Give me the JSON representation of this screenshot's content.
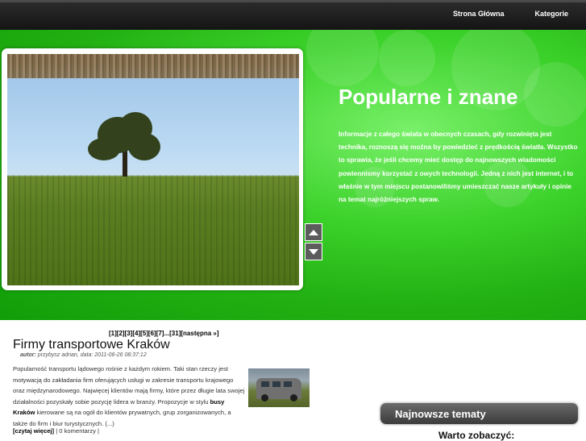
{
  "nav": {
    "items": [
      {
        "label": "Strona Główna"
      },
      {
        "label": "Kategorie"
      }
    ]
  },
  "hero": {
    "title": "Popularne i znane",
    "text": "Informacje z całego świata w obecnych czasach, gdy rozwinięta jest technika, roznoszą się można by powiedzieć z prędkością światła. Wszystko to sprawia, że jeśli chcemy mieć dostęp do najnowszych wiadomości powiennismy korzystać z owych technologii. Jedną z nich jest internet, i to właśnie w tym miejscu postanowiliśmy umieszczać nasze artykuły i opinie na temat najróżniejszych spraw.",
    "slider": {
      "up_icon": "arrow-up-icon",
      "down_icon": "arrow-down-icon"
    }
  },
  "pagination": {
    "pages": [
      "[1]",
      "[2]",
      "[3]",
      "[4]",
      "[5]",
      "[6]",
      "[7]",
      "...",
      "[31]"
    ],
    "next": "[następna »]"
  },
  "post": {
    "title": "Firmy transportowe Kraków",
    "author_label": "autor:",
    "author": "przybysz adrian,",
    "date": "data: 2011-06-26 08:37:12",
    "body_before": "Popularność transportu lądowego rośnie z każdym rokiem. Taki stan rzeczy jest motywacją do zakładania firm oferujących usługi w zakresie transportu krajowego oraz międzynarodowego. Najwięcej klientów mają firmy, które przez długie lata swojej działalności pozyskały sobie pozycję lidera w branży. Propozycje w stylu ",
    "body_bold": "busy Kraków",
    "body_after": " kierowane są na ogół do klientów prywatnych, grup zorganizowanych, a także do firm i biur turystycznych. (...)",
    "read_more": "[czytaj więcej]",
    "comments": "| 0 komentarzy |"
  },
  "sidebar": {
    "box_title": "Najnowsze tematy",
    "subtitle": "Warto zobaczyć:"
  }
}
